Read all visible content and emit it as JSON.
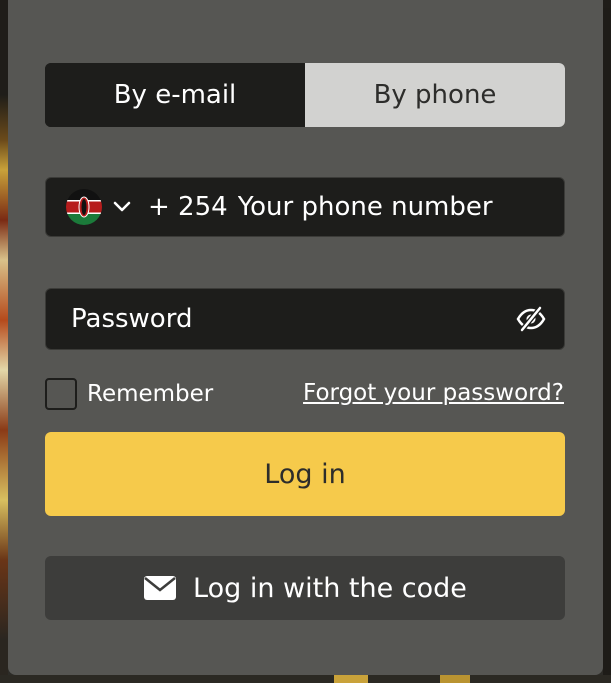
{
  "tabs": [
    {
      "label": "By e-mail",
      "active": false
    },
    {
      "label": "By phone",
      "active": true
    }
  ],
  "phone": {
    "country_icon": "kenya-flag-icon",
    "code": "+ 254",
    "placeholder": "Your phone number",
    "value": ""
  },
  "password": {
    "placeholder": "Password",
    "value": "",
    "toggle_icon": "eye-slash-icon"
  },
  "remember": {
    "label": "Remember",
    "checked": false
  },
  "forgot_link": "Forgot your password?",
  "login_button": "Log in",
  "code_button": {
    "label": "Log in with the code",
    "icon": "envelope-icon"
  },
  "colors": {
    "panel": "#565653",
    "field_bg": "#1d1d1b",
    "tab_active_bg": "#d2d2d0",
    "primary": "#f6ca4b",
    "secondary_button": "#3d3d3b"
  }
}
